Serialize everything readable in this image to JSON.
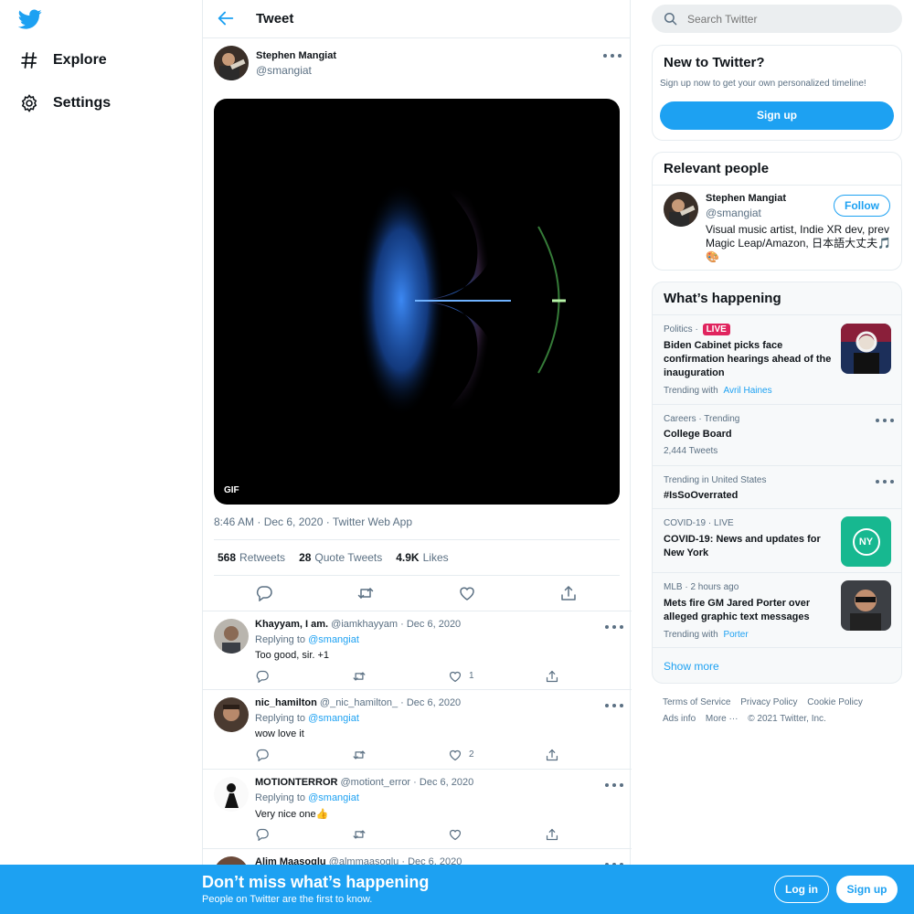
{
  "nav": {
    "logo_icon": "twitter-bird-icon",
    "items": [
      {
        "label": "Explore",
        "icon": "hashtag-icon"
      },
      {
        "label": "Settings",
        "icon": "gear-icon"
      }
    ]
  },
  "header": {
    "title": "Tweet",
    "back_icon": "arrow-left-icon"
  },
  "tweet": {
    "author_name": "Stephen Mangiat",
    "author_handle": "@smangiat",
    "media_badge": "GIF",
    "timestamp": "8:46 AM · Dec 6, 2020 · Twitter Web App",
    "stats": [
      {
        "count": "568",
        "label": "Retweets"
      },
      {
        "count": "28",
        "label": "Quote Tweets"
      },
      {
        "count": "4.9K",
        "label": "Likes"
      }
    ]
  },
  "replies": [
    {
      "name": "Khayyam, I am.",
      "handle": "@iamkhayyam",
      "date": "· Dec 6, 2020",
      "replying_prefix": "Replying to",
      "replying_to": "@smangiat",
      "text": "Too good, sir. +1",
      "likes": "1"
    },
    {
      "name": "nic_hamilton",
      "handle": "@_nic_hamilton_",
      "date": "· Dec 6, 2020",
      "replying_prefix": "Replying to",
      "replying_to": "@smangiat",
      "text": "wow love it",
      "likes": "2"
    },
    {
      "name": "MOTIONTERROR",
      "handle": "@motiont_error",
      "date": "· Dec 6, 2020",
      "replying_prefix": "Replying to",
      "replying_to": "@smangiat",
      "text": "Very nice one👍",
      "likes": ""
    },
    {
      "name": "Alim Maasoglu",
      "handle": "@almmaasoglu",
      "date": "· Dec 6, 2020",
      "replying_prefix": "",
      "replying_to": "",
      "text": "",
      "likes": ""
    }
  ],
  "search": {
    "placeholder": "Search Twitter"
  },
  "new_to_twitter": {
    "title": "New to Twitter?",
    "subtitle": "Sign up now to get your own personalized timeline!",
    "button": "Sign up"
  },
  "relevant_people": {
    "title": "Relevant people",
    "name": "Stephen Mangiat",
    "handle": "@smangiat",
    "follow": "Follow",
    "bio": "Visual music artist, Indie XR dev, prev Magic Leap/Amazon, 日本語大丈夫🎵🎨"
  },
  "whats_happening": {
    "title": "What’s happening",
    "trends": [
      {
        "category": "Politics ·",
        "live_badge": "LIVE",
        "title": "Biden Cabinet picks face confirmation hearings ahead of the inauguration",
        "sub_prefix": "Trending with",
        "sub_link": "Avril Haines"
      },
      {
        "category": "Careers · Trending",
        "title": "College Board",
        "sub": "2,444 Tweets"
      },
      {
        "category": "Trending in United States",
        "title": "#IsSoOverrated"
      },
      {
        "category": "COVID-19 · LIVE",
        "title": "COVID-19: News and updates for New York",
        "thumb_text": "NY"
      },
      {
        "category": "MLB · 2 hours ago",
        "title": "Mets fire GM Jared Porter over alleged graphic text messages",
        "sub_prefix": "Trending with",
        "sub_link": "Porter"
      }
    ],
    "show_more": "Show more"
  },
  "footer": {
    "links": [
      "Terms of Service",
      "Privacy Policy",
      "Cookie Policy",
      "Ads info",
      "More ···"
    ],
    "copyright": "© 2021 Twitter, Inc."
  },
  "bottom_bar": {
    "heading": "Don’t miss what’s happening",
    "sub": "People on Twitter are the first to know.",
    "login": "Log in",
    "signup": "Sign up"
  },
  "colors": {
    "brand": "#1da1f2",
    "live": "#e0245e",
    "text": "#0f1419",
    "muted": "#5b7083"
  }
}
